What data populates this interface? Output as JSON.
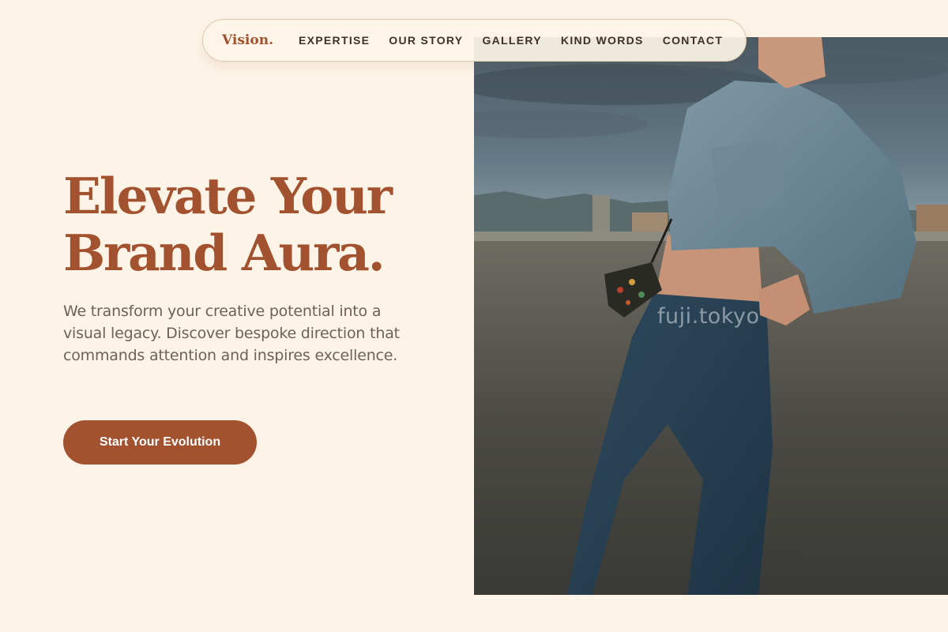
{
  "nav": {
    "brand": "Vision.",
    "links": [
      "EXPERTISE",
      "OUR STORY",
      "GALLERY",
      "KIND WORDS",
      "CONTACT"
    ]
  },
  "hero": {
    "headline_line1": "Elevate Your",
    "headline_line2": "Brand Aura.",
    "subtitle": "We transform your creative potential into a visual legacy. Discover bespoke direction that commands attention and inspires excellence.",
    "cta_label": "Start Your Evolution",
    "image_watermark": "fuji.tokyo"
  },
  "colors": {
    "background": "#fdf4e7",
    "accent": "#a3522f",
    "nav_text": "#3d3129",
    "body_text": "#6e6159"
  }
}
